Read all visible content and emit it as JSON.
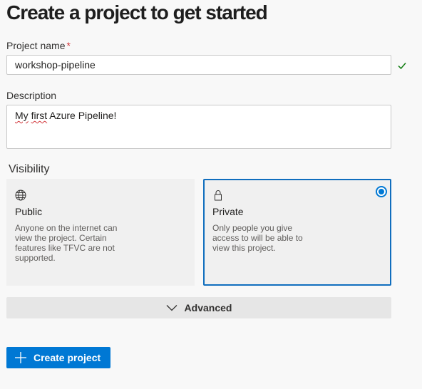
{
  "page": {
    "title": "Create a project to get started"
  },
  "form": {
    "name_label": "Project name",
    "name_required_mark": "*",
    "name_value": "workshop-pipeline",
    "description_label": "Description",
    "description_word1": "My",
    "description_word2": "first",
    "description_rest": " Azure Pipeline!"
  },
  "visibility": {
    "label": "Visibility",
    "options": [
      {
        "icon": "globe-icon",
        "name": "Public",
        "description": "Anyone on the internet can view the project. Certain features like TFVC are not supported.",
        "selected": false
      },
      {
        "icon": "lock-icon",
        "name": "Private",
        "description": "Only people you give access to will be able to view this project.",
        "selected": true
      }
    ]
  },
  "advanced": {
    "label": "Advanced"
  },
  "actions": {
    "create_label": "Create project"
  },
  "colors": {
    "accent": "#0078d4",
    "required": "#d13438",
    "valid": "#107c10"
  }
}
